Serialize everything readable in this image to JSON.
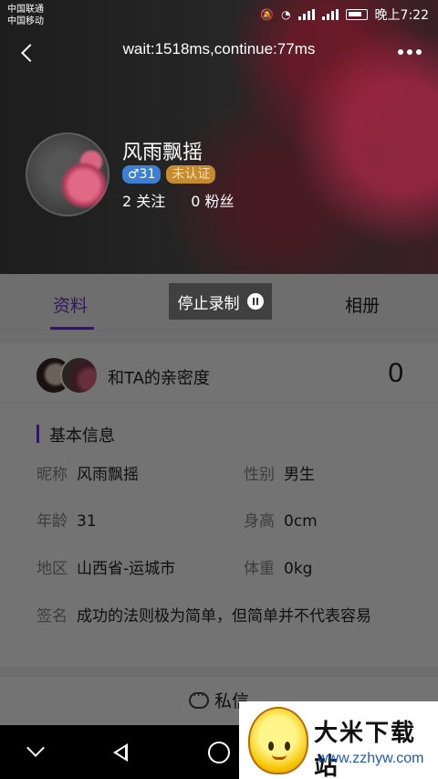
{
  "status_bar": {
    "carrier1": "中国联通",
    "carrier2": "中国移动",
    "time": "晚上7:22",
    "icons": [
      "mute-icon",
      "hd-icon",
      "wifi-icon",
      "3g-signal-icon",
      "4g-signal-icon",
      "battery-icon"
    ]
  },
  "header": {
    "timing": "wait:1518ms,continue:77ms",
    "back_icon": "back-arrow-icon",
    "more_icon": "more-dots-icon"
  },
  "profile": {
    "username": "风雨飘摇",
    "gender_age": "♂31",
    "certification": "未认证",
    "following": "2 关注",
    "followers": "0 粉丝"
  },
  "tabs": {
    "info": "资料",
    "album": "相册",
    "active": "info"
  },
  "recording": {
    "label": "停止录制"
  },
  "intimacy": {
    "label": "和TA的亲密度",
    "value": "0"
  },
  "basic_info": {
    "title": "基本信息",
    "nickname_k": "昵称",
    "nickname_v": "风雨飘摇",
    "gender_k": "性别",
    "gender_v": "男生",
    "age_k": "年龄",
    "age_v": "31",
    "height_k": "身高",
    "height_v": "0cm",
    "region_k": "地区",
    "region_v": "山西省-运城市",
    "weight_k": "体重",
    "weight_v": "0kg",
    "signature_k": "签名",
    "signature_v": "成功的法则极为简单，但简单并不代表容易"
  },
  "actions": {
    "message": "私信"
  },
  "watermark": {
    "title": "大米下载站",
    "url": "www.zzhyw.com"
  },
  "colors": {
    "accent": "#6b38c6",
    "gender_badge": "#3f7fd3",
    "cert_badge": "#c58b2f"
  }
}
